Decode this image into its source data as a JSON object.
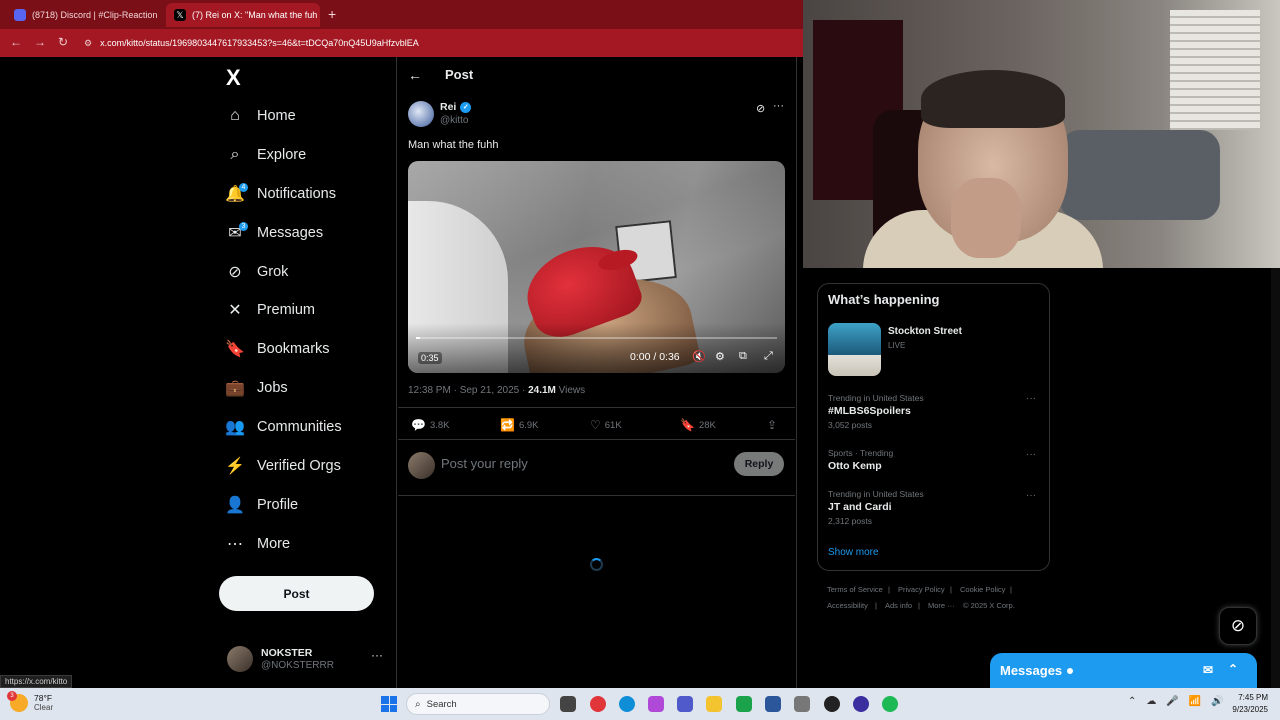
{
  "browser": {
    "tabs": [
      {
        "title": "(8718) Discord | #Clip-Reaction",
        "active": false
      },
      {
        "title": "(7) Rei on X: \"Man what the fuh",
        "active": true
      }
    ],
    "new_tab": "+",
    "url": "x.com/kitto/status/1969803447617933453?s=46&t=tDCQa70nQ45U9aHfzvblEA",
    "status_url": "https://x.com/kitto"
  },
  "sidebar": {
    "logo": "X",
    "items": [
      {
        "label": "Home",
        "icon": "home-icon",
        "glyph": "⌂"
      },
      {
        "label": "Explore",
        "icon": "search-icon",
        "glyph": "⌕"
      },
      {
        "label": "Notifications",
        "icon": "bell-icon",
        "glyph": "🔔",
        "badge": "4"
      },
      {
        "label": "Messages",
        "icon": "envelope-icon",
        "glyph": "✉",
        "badge": "3"
      },
      {
        "label": "Grok",
        "icon": "grok-icon",
        "glyph": "⊘"
      },
      {
        "label": "Premium",
        "icon": "x-icon",
        "glyph": "✕"
      },
      {
        "label": "Bookmarks",
        "icon": "bookmark-icon",
        "glyph": "🔖"
      },
      {
        "label": "Jobs",
        "icon": "briefcase-icon",
        "glyph": "💼"
      },
      {
        "label": "Communities",
        "icon": "people-icon",
        "glyph": "👥"
      },
      {
        "label": "Verified Orgs",
        "icon": "lightning-icon",
        "glyph": "⚡"
      },
      {
        "label": "Profile",
        "icon": "person-icon",
        "glyph": "👤"
      },
      {
        "label": "More",
        "icon": "more-circle-icon",
        "glyph": "⋯"
      }
    ],
    "post_button": "Post",
    "account": {
      "display_name": "NOKSTER",
      "handle": "@NOKSTERRR",
      "menu": "···"
    }
  },
  "main": {
    "header_title": "Post",
    "post": {
      "author_name": "Rei",
      "author_handle": "@kitto",
      "text": "Man what the fuhh",
      "video": {
        "elapsed_badge": "0:35",
        "time": "0:00 / 0:36",
        "progress": 0.01
      },
      "timestamp": "12:38 PM · Sep 21, 2025 · ",
      "views_count": "24.1M",
      "views_label": " Views",
      "actions": [
        {
          "name": "reply",
          "icon": "reply-icon",
          "glyph": "💬",
          "count": "3.8K"
        },
        {
          "name": "repost",
          "icon": "repost-icon",
          "glyph": "🔁",
          "count": "6.9K"
        },
        {
          "name": "like",
          "icon": "heart-icon",
          "glyph": "♡",
          "count": "61K"
        },
        {
          "name": "bookmark",
          "icon": "bookmark-icon",
          "glyph": "🔖",
          "count": "28K"
        }
      ]
    },
    "reply": {
      "placeholder": "Post your reply",
      "button": "Reply"
    }
  },
  "right": {
    "whats_happening": "What’s happening",
    "trends": [
      {
        "context": "",
        "name": "Stockton Street",
        "meta": "LIVE"
      },
      {
        "context": "Trending in United States",
        "name": "#MLBS6Spoilers",
        "meta": "3,052 posts"
      },
      {
        "context": "Sports · Trending",
        "name": "Otto Kemp",
        "meta": ""
      },
      {
        "context": "Trending in United States",
        "name": "JT and Cardi",
        "meta": "2,312 posts"
      }
    ],
    "show_more": "Show more",
    "footer": [
      "Terms of Service",
      "Privacy Policy",
      "Cookie Policy",
      "Accessibility",
      "Ads info",
      "More ···",
      "© 2025 X Corp."
    ],
    "messages_drawer": "Messages"
  },
  "taskbar": {
    "weather_temp": "78°F",
    "weather_cond": "Clear",
    "weather_badge": "3",
    "search": "Search",
    "time": "7:45 PM",
    "date": "9/23/2025"
  }
}
